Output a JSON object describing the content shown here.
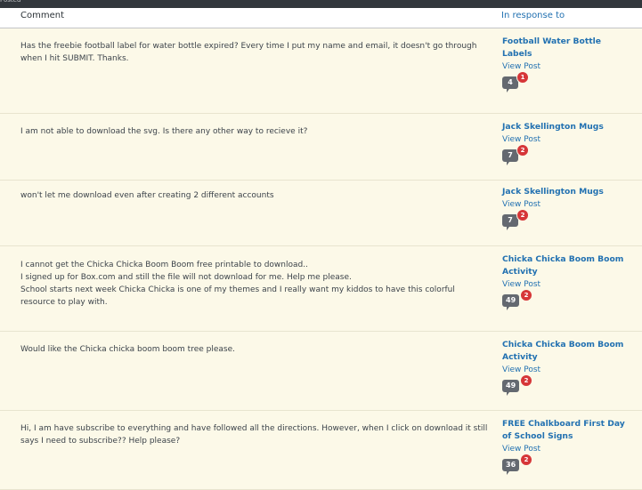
{
  "topbar": {
    "label": "Posted"
  },
  "table": {
    "headers": {
      "comment": "Comment",
      "in_response_to": "In response to"
    },
    "rows": [
      {
        "comment_lines": [
          "Has the freebie football label for water bottle expired? Every time I put my name and email, it doesn't go through when I hit SUBMIT. Thanks."
        ],
        "post_title": "Football Water Bottle Labels",
        "view_post": "View Post",
        "approved_count": "4",
        "pending_count": "1"
      },
      {
        "comment_lines": [
          "I am not able to download the svg. Is there any other way to recieve it?"
        ],
        "post_title": "Jack Skellington Mugs",
        "view_post": "View Post",
        "approved_count": "7",
        "pending_count": "2"
      },
      {
        "comment_lines": [
          "won't let me download even after creating 2 different accounts"
        ],
        "post_title": "Jack Skellington Mugs",
        "view_post": "View Post",
        "approved_count": "7",
        "pending_count": "2"
      },
      {
        "comment_lines": [
          "I cannot get the Chicka Chicka Boom Boom free printable to download..",
          "I signed up for Box.com and still the file will not download for me. Help me please.",
          "School starts next week Chicka Chicka is one of my themes and I really want my kiddos to have this colorful resource to play with."
        ],
        "post_title": "Chicka Chicka Boom Boom Activity",
        "view_post": "View Post",
        "approved_count": "49",
        "pending_count": "2"
      },
      {
        "comment_lines": [
          "Would like the Chicka chicka boom boom tree please."
        ],
        "post_title": "Chicka Chicka Boom Boom Activity",
        "view_post": "View Post",
        "approved_count": "49",
        "pending_count": "2"
      },
      {
        "comment_lines": [
          "Hi, I am have subscribe to everything and have followed all the directions. However, when I click on download it still says I need to subscribe?? Help please?"
        ],
        "post_title": "FREE Chalkboard First Day of School Signs",
        "view_post": "View Post",
        "approved_count": "36",
        "pending_count": "2"
      }
    ]
  },
  "colors": {
    "row_background": "#fcf9e8",
    "link": "#2271b1",
    "count_bubble": "#646970",
    "pending_badge": "#d63638",
    "topbar": "#32373c"
  }
}
